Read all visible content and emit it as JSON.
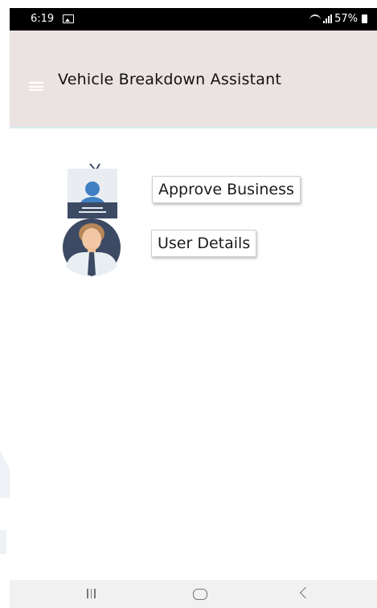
{
  "status_bar": {
    "time": "6:19",
    "battery_percent": "57%",
    "icons": [
      "gallery-icon",
      "wifi-icon",
      "signal-icon",
      "battery-icon"
    ]
  },
  "toolbar": {
    "title": "Vehicle Breakdown Assistant",
    "menu_icon": "hamburger-menu-icon"
  },
  "main": {
    "illustration": "admin-user-icon",
    "buttons": {
      "approve_business": "Approve Business",
      "user_details": "User Details"
    }
  },
  "nav_bar": {
    "recents": "recents-icon",
    "home": "home-icon",
    "back": "back-icon"
  },
  "colors": {
    "toolbar_bg": "#ebe3e2",
    "status_bg": "#000000",
    "accent_blue": "#3f7fc2",
    "navy": "#3d4a63"
  }
}
